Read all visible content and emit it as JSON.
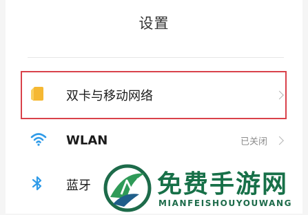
{
  "header": {
    "title": "设置"
  },
  "settings": {
    "items": [
      {
        "label": "双卡与移动网络",
        "status": ""
      },
      {
        "label": "WLAN",
        "status": "已关闭"
      },
      {
        "label": "蓝牙",
        "status": ""
      }
    ]
  },
  "watermark": {
    "main": "免费手游网",
    "sub": "MIANFEISHOUYOUWANG"
  },
  "colors": {
    "highlight": "#d9414a",
    "sim_icon": "#f5b833",
    "wifi_icon": "#2f9be8",
    "bt_icon": "#2f9be8",
    "watermark": "#177048"
  },
  "icons": [
    "sim-card-icon",
    "wifi-icon",
    "bluetooth-icon",
    "chevron-right-icon",
    "watermark-logo-icon"
  ]
}
